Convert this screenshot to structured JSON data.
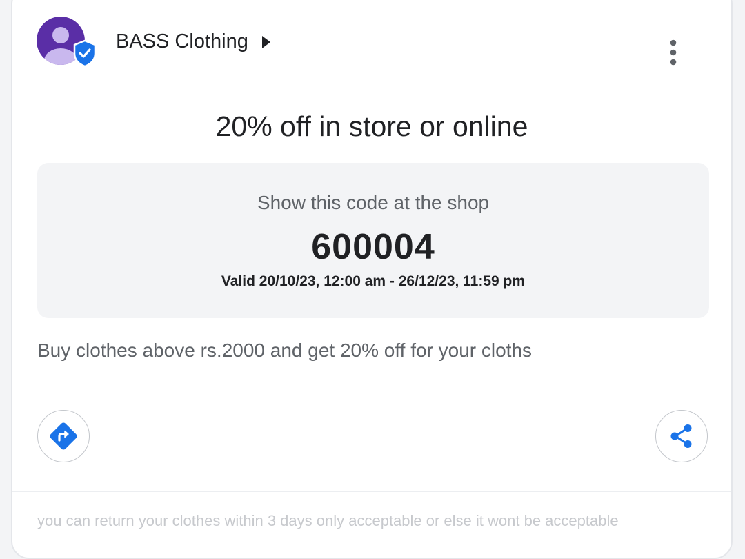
{
  "merchant": {
    "name": "BASS Clothing",
    "avatar_icon": "person-avatar-icon",
    "verified_icon": "verified-shield-icon"
  },
  "offer": {
    "title": "20% off in store or online",
    "code_label": "Show this code at the shop",
    "code": "600004",
    "validity": "Valid 20/10/23, 12:00 am - 26/12/23, 11:59 pm",
    "description": "Buy clothes above rs.2000 and get 20% off for your cloths",
    "terms": "you can return your clothes within 3 days only acceptable or else it wont be acceptable"
  },
  "actions": {
    "directions_icon": "directions-icon",
    "share_icon": "share-icon",
    "more_icon": "more-vert-icon"
  },
  "colors": {
    "accent": "#1a73e8",
    "avatar_bg": "#5a2ea6",
    "text_primary": "#202124",
    "text_secondary": "#5f6368"
  }
}
